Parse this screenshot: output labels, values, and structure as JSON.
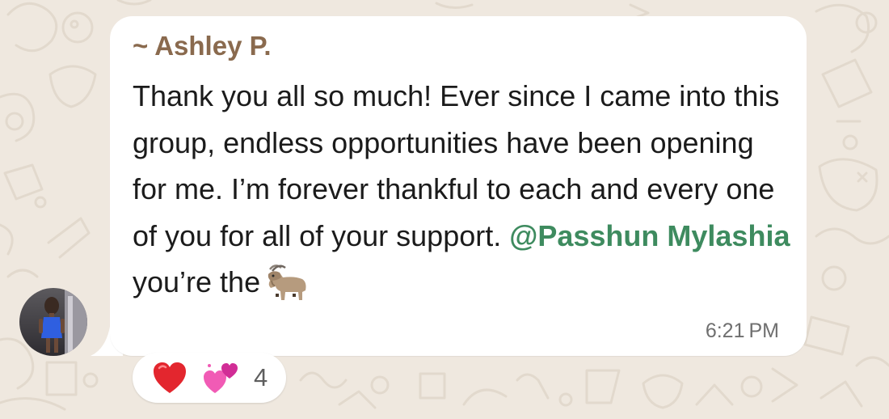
{
  "message": {
    "sender": "~ Ashley P.",
    "text_before_mention": "Thank you all so much! Ever since I came into this group, endless opportunities have been opening for me. I’m forever thankful to each and every one of you for all of your support. ",
    "mention": "@Passhun Mylashia",
    "text_after_mention": " you’re the",
    "inline_emoji": "goat-icon",
    "timestamp": "6:21 PM"
  },
  "reactions": {
    "emojis": [
      "red-heart-icon",
      "two-hearts-icon"
    ],
    "count": "4"
  },
  "colors": {
    "wallpaper": "#efe8df",
    "bubble": "#ffffff",
    "sender": "#8a6a4e",
    "mention": "#3e8b5f",
    "timestamp": "#6f6f6f"
  }
}
